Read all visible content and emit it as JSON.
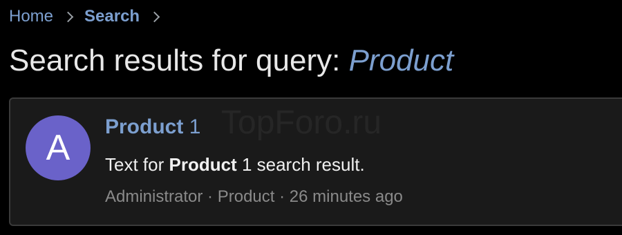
{
  "breadcrumb": {
    "home_label": "Home",
    "current_label": "Search"
  },
  "page": {
    "title_prefix": "Search results for query:",
    "query": "Product"
  },
  "result": {
    "avatar_letter": "A",
    "title_highlight": "Product",
    "title_rest": "1",
    "snippet_before": "Text for",
    "snippet_highlight": "Product",
    "snippet_after": "1 search result.",
    "author": "Administrator",
    "separator": "·",
    "category": "Product",
    "time_ago": "26 minutes ago"
  },
  "watermark": {
    "text": "TopForo.ru"
  },
  "colors": {
    "background": "#000000",
    "link": "#7c9fcf",
    "card": "#1a1a1a",
    "avatar": "#6a62c9",
    "meta": "#8a8a8a"
  }
}
